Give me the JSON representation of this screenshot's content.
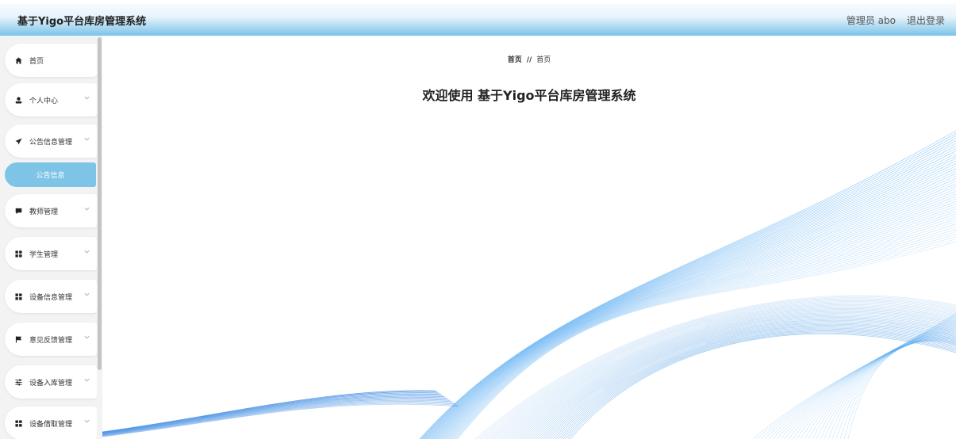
{
  "header": {
    "title": "基于Yigo平台库房管理系统",
    "user_label": "管理员 abo",
    "logout_label": "退出登录"
  },
  "sidebar": {
    "items": [
      {
        "label": "首页",
        "icon": "home-icon"
      },
      {
        "label": "个人中心",
        "icon": "user-icon"
      },
      {
        "label": "公告信息管理",
        "icon": "send-icon"
      },
      {
        "label": "教师管理",
        "icon": "chat-icon"
      },
      {
        "label": "学生管理",
        "icon": "grid-icon"
      },
      {
        "label": "设备信息管理",
        "icon": "grid-icon"
      },
      {
        "label": "意见反馈管理",
        "icon": "flag-icon"
      },
      {
        "label": "设备入库管理",
        "icon": "sliders-icon"
      },
      {
        "label": "设备借取管理",
        "icon": "grid-icon"
      }
    ],
    "sub_item": {
      "label": "公告信息"
    }
  },
  "main": {
    "breadcrumb": {
      "first": "首页",
      "separator": "//",
      "second": "首页"
    },
    "welcome": "欢迎使用 基于Yigo平台库房管理系统"
  },
  "colors": {
    "accent": "#7ec4e6",
    "header_bottom": "#79c3ea",
    "wave": "#3f9ff0"
  }
}
